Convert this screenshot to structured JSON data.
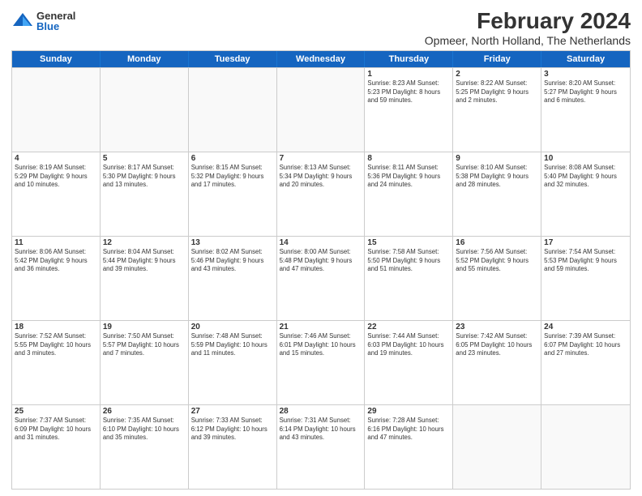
{
  "header": {
    "logo": {
      "general": "General",
      "blue": "Blue"
    },
    "title": "February 2024",
    "location": "Opmeer, North Holland, The Netherlands"
  },
  "days_of_week": [
    "Sunday",
    "Monday",
    "Tuesday",
    "Wednesday",
    "Thursday",
    "Friday",
    "Saturday"
  ],
  "weeks": [
    [
      {
        "day": "",
        "info": ""
      },
      {
        "day": "",
        "info": ""
      },
      {
        "day": "",
        "info": ""
      },
      {
        "day": "",
        "info": ""
      },
      {
        "day": "1",
        "info": "Sunrise: 8:23 AM\nSunset: 5:23 PM\nDaylight: 8 hours\nand 59 minutes."
      },
      {
        "day": "2",
        "info": "Sunrise: 8:22 AM\nSunset: 5:25 PM\nDaylight: 9 hours\nand 2 minutes."
      },
      {
        "day": "3",
        "info": "Sunrise: 8:20 AM\nSunset: 5:27 PM\nDaylight: 9 hours\nand 6 minutes."
      }
    ],
    [
      {
        "day": "4",
        "info": "Sunrise: 8:19 AM\nSunset: 5:29 PM\nDaylight: 9 hours\nand 10 minutes."
      },
      {
        "day": "5",
        "info": "Sunrise: 8:17 AM\nSunset: 5:30 PM\nDaylight: 9 hours\nand 13 minutes."
      },
      {
        "day": "6",
        "info": "Sunrise: 8:15 AM\nSunset: 5:32 PM\nDaylight: 9 hours\nand 17 minutes."
      },
      {
        "day": "7",
        "info": "Sunrise: 8:13 AM\nSunset: 5:34 PM\nDaylight: 9 hours\nand 20 minutes."
      },
      {
        "day": "8",
        "info": "Sunrise: 8:11 AM\nSunset: 5:36 PM\nDaylight: 9 hours\nand 24 minutes."
      },
      {
        "day": "9",
        "info": "Sunrise: 8:10 AM\nSunset: 5:38 PM\nDaylight: 9 hours\nand 28 minutes."
      },
      {
        "day": "10",
        "info": "Sunrise: 8:08 AM\nSunset: 5:40 PM\nDaylight: 9 hours\nand 32 minutes."
      }
    ],
    [
      {
        "day": "11",
        "info": "Sunrise: 8:06 AM\nSunset: 5:42 PM\nDaylight: 9 hours\nand 36 minutes."
      },
      {
        "day": "12",
        "info": "Sunrise: 8:04 AM\nSunset: 5:44 PM\nDaylight: 9 hours\nand 39 minutes."
      },
      {
        "day": "13",
        "info": "Sunrise: 8:02 AM\nSunset: 5:46 PM\nDaylight: 9 hours\nand 43 minutes."
      },
      {
        "day": "14",
        "info": "Sunrise: 8:00 AM\nSunset: 5:48 PM\nDaylight: 9 hours\nand 47 minutes."
      },
      {
        "day": "15",
        "info": "Sunrise: 7:58 AM\nSunset: 5:50 PM\nDaylight: 9 hours\nand 51 minutes."
      },
      {
        "day": "16",
        "info": "Sunrise: 7:56 AM\nSunset: 5:52 PM\nDaylight: 9 hours\nand 55 minutes."
      },
      {
        "day": "17",
        "info": "Sunrise: 7:54 AM\nSunset: 5:53 PM\nDaylight: 9 hours\nand 59 minutes."
      }
    ],
    [
      {
        "day": "18",
        "info": "Sunrise: 7:52 AM\nSunset: 5:55 PM\nDaylight: 10 hours\nand 3 minutes."
      },
      {
        "day": "19",
        "info": "Sunrise: 7:50 AM\nSunset: 5:57 PM\nDaylight: 10 hours\nand 7 minutes."
      },
      {
        "day": "20",
        "info": "Sunrise: 7:48 AM\nSunset: 5:59 PM\nDaylight: 10 hours\nand 11 minutes."
      },
      {
        "day": "21",
        "info": "Sunrise: 7:46 AM\nSunset: 6:01 PM\nDaylight: 10 hours\nand 15 minutes."
      },
      {
        "day": "22",
        "info": "Sunrise: 7:44 AM\nSunset: 6:03 PM\nDaylight: 10 hours\nand 19 minutes."
      },
      {
        "day": "23",
        "info": "Sunrise: 7:42 AM\nSunset: 6:05 PM\nDaylight: 10 hours\nand 23 minutes."
      },
      {
        "day": "24",
        "info": "Sunrise: 7:39 AM\nSunset: 6:07 PM\nDaylight: 10 hours\nand 27 minutes."
      }
    ],
    [
      {
        "day": "25",
        "info": "Sunrise: 7:37 AM\nSunset: 6:09 PM\nDaylight: 10 hours\nand 31 minutes."
      },
      {
        "day": "26",
        "info": "Sunrise: 7:35 AM\nSunset: 6:10 PM\nDaylight: 10 hours\nand 35 minutes."
      },
      {
        "day": "27",
        "info": "Sunrise: 7:33 AM\nSunset: 6:12 PM\nDaylight: 10 hours\nand 39 minutes."
      },
      {
        "day": "28",
        "info": "Sunrise: 7:31 AM\nSunset: 6:14 PM\nDaylight: 10 hours\nand 43 minutes."
      },
      {
        "day": "29",
        "info": "Sunrise: 7:28 AM\nSunset: 6:16 PM\nDaylight: 10 hours\nand 47 minutes."
      },
      {
        "day": "",
        "info": ""
      },
      {
        "day": "",
        "info": ""
      }
    ]
  ]
}
